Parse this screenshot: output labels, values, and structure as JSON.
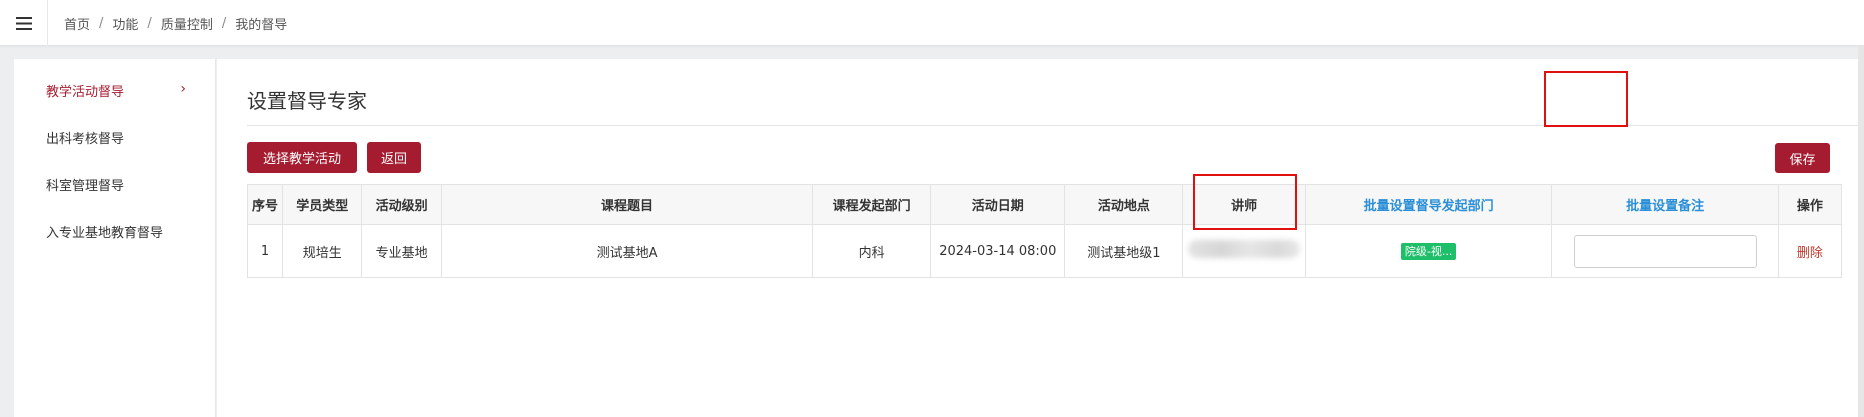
{
  "topbar": {
    "menu_icon": "hamburger-menu-icon",
    "breadcrumb": [
      "首页",
      "功能",
      "质量控制",
      "我的督导"
    ]
  },
  "sidebar": {
    "items": [
      {
        "label": "教学活动督导",
        "active": true
      },
      {
        "label": "出科考核督导",
        "active": false
      },
      {
        "label": "科室管理督导",
        "active": false
      },
      {
        "label": "入专业基地教育督导",
        "active": false
      }
    ],
    "chevron": "›"
  },
  "main": {
    "title": "设置督导专家",
    "buttons": {
      "choose_activity": "选择教学活动",
      "back": "返回",
      "save": "保存"
    },
    "table": {
      "headers": [
        "序号",
        "学员类型",
        "活动级别",
        "课程题目",
        "课程发起部门",
        "活动日期",
        "活动地点",
        "讲师",
        "批量设置督导发起部门",
        "批量设置备注",
        "操作"
      ],
      "rows": [
        {
          "index": "1",
          "student_type": "规培生",
          "activity_level": "专业基地",
          "course_title": "测试基地A",
          "course_dept": "内科",
          "activity_date": "2024-03-14 08:00",
          "activity_place": "测试基地级1",
          "lecturer": "",
          "supervise_dept_tag": "院级-视...",
          "note_value": "",
          "action": "删除"
        }
      ]
    }
  },
  "colors": {
    "brand": "#a51c30",
    "link": "#2b8fd8",
    "tag_green": "#1fbf6a",
    "highlight": "#e01010"
  }
}
